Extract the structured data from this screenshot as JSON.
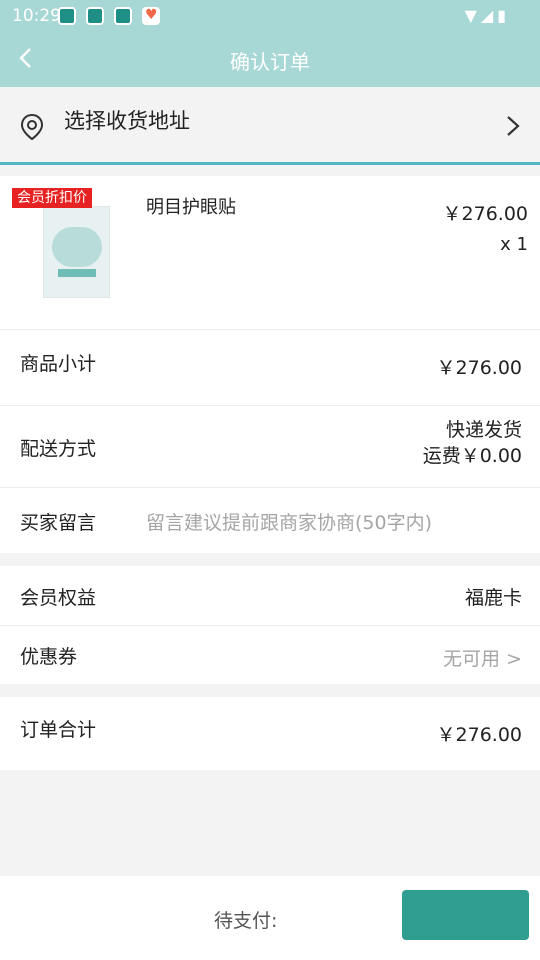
{
  "status_bar": {
    "time": "10:29",
    "icons": [
      "app-icon",
      "app-icon",
      "app-icon",
      "heart-app-icon",
      "wifi-icon",
      "signal-icon",
      "battery-icon"
    ]
  },
  "header": {
    "title": "确认订单",
    "back_icon": "chevron-left-icon"
  },
  "address": {
    "label": "选择收货地址",
    "icon": "location-pin-icon"
  },
  "product": {
    "badge": "会员折扣价",
    "name": "明目护眼贴",
    "price": "￥276.00",
    "qty": "x 1"
  },
  "subtotal": {
    "label": "商品小计",
    "value": "￥276.00"
  },
  "delivery": {
    "label": "配送方式",
    "method": "快递发货",
    "fee": "运费￥0.00"
  },
  "message": {
    "label": "买家留言",
    "placeholder": "留言建议提前跟商家协商(50字内)"
  },
  "membership": {
    "label": "会员权益",
    "value": "福鹿卡"
  },
  "coupon": {
    "label": "优惠券",
    "value": "无可用 >"
  },
  "total": {
    "label": "订单合计",
    "value": "￥276.00"
  },
  "footer": {
    "due_label": "待支付:"
  },
  "colors": {
    "header": "#a8d8d5",
    "accent": "#55b6c6",
    "badge": "#e62222"
  }
}
